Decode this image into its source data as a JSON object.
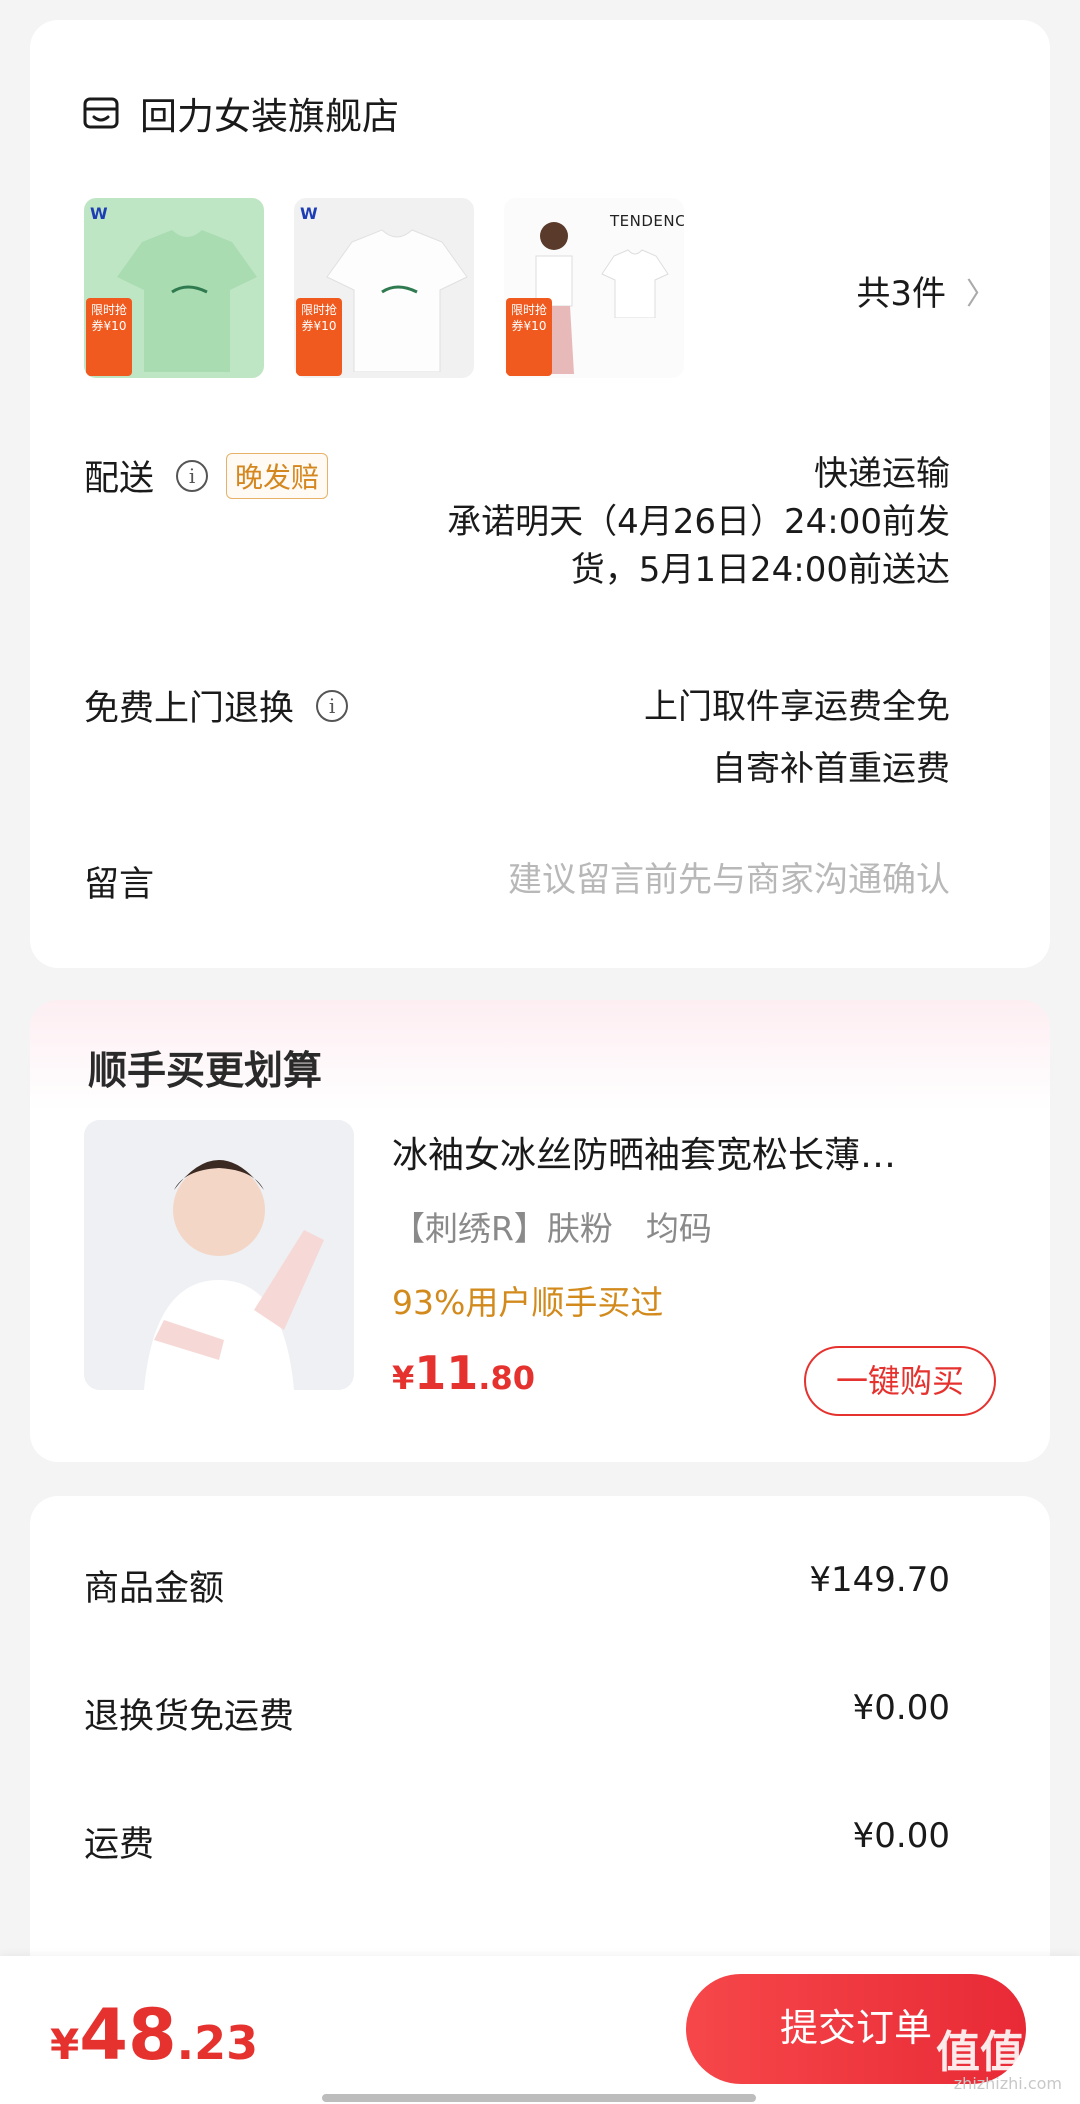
{
  "store": {
    "name": "回力女装旗舰店",
    "icon": "store-icon"
  },
  "items": {
    "count_label": "共3件",
    "thumbs": [
      {
        "kind": "green-shirt",
        "badge": "限时抢券¥10"
      },
      {
        "kind": "white-shirt",
        "badge": "限时抢券¥10"
      },
      {
        "kind": "model-photo",
        "badge": "限时抢券¥10",
        "brand_text": "TENDENCY"
      }
    ]
  },
  "delivery": {
    "label": "配送",
    "tag": "晚发赔",
    "method": "快递运输",
    "promise_line1": "承诺明天（4月26日）24:00前发",
    "promise_line2": "货，5月1日24:00前送达"
  },
  "returns": {
    "label": "免费上门退换",
    "line1": "上门取件享运费全免",
    "line2": "自寄补首重运费"
  },
  "message": {
    "label": "留言",
    "placeholder": "建议留言前先与商家沟通确认"
  },
  "upsell": {
    "title": "顺手买更划算",
    "name": "冰袖女冰丝防晒袖套宽松长薄…",
    "spec": "【刺绣R】肤粉　均码",
    "promo": "93%用户顺手买过",
    "price_cur": "¥",
    "price_int": "11",
    "price_dec": ".80",
    "buy_label": "一键购买"
  },
  "summary": {
    "rows": [
      {
        "label": "商品金额",
        "value": "¥149.70"
      },
      {
        "label": "退换货免运费",
        "value": "¥0.00"
      },
      {
        "label": "运费",
        "value": "¥0.00"
      }
    ]
  },
  "bottom": {
    "total_cur": "¥",
    "total_int": "48",
    "total_dec": ".23",
    "submit_label": "提交订单",
    "watermark": "值值值",
    "watermark_url": "zhizhizhi.com"
  },
  "colors": {
    "accent": "#e5322f",
    "promo": "#d28a1c",
    "tag_border": "#e8b16a"
  }
}
